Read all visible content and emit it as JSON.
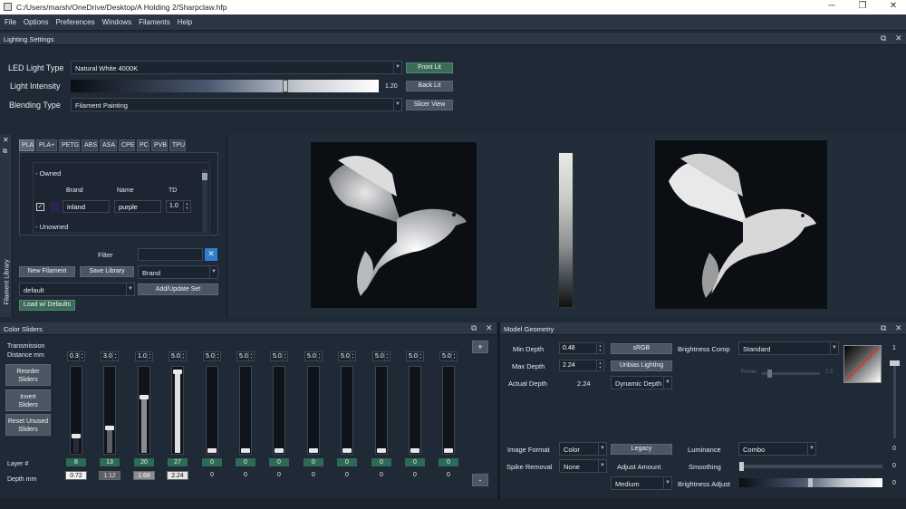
{
  "window": {
    "title": "C:/Users/marsh/OneDrive/Desktop/A Holding 2/Sharpclaw.hfp",
    "minimize": "─",
    "maximize": "❐",
    "close": "✕"
  },
  "menu": [
    "File",
    "Options",
    "Preferences",
    "Windows",
    "Filaments",
    "Help"
  ],
  "lighting": {
    "title": "Lighting Settings",
    "led_label": "LED Light Type",
    "led_value": "Natural White 4000K",
    "intensity_label": "Light Intensity",
    "intensity_value": "1.20",
    "intensity_fraction": 0.7,
    "blending_label": "Blending Type",
    "blending_value": "Filament Painting",
    "front_lit": "Front Lit",
    "back_lit": "Back Lit",
    "slicer_view": "Slicer View"
  },
  "library": {
    "side_label": "Filament Library",
    "tabs": [
      "PLA",
      "PLA+",
      "PETG",
      "ABS",
      "ASA",
      "CPE",
      "PC",
      "PVB",
      "TPU"
    ],
    "owned": "- Owned",
    "unowned": "- Unowned",
    "col_brand": "Brand",
    "col_name": "Name",
    "col_td": "TD",
    "row": {
      "brand": "inland",
      "name": "purple",
      "td": "1.0",
      "swatch": "#2a2350"
    },
    "filter_label": "Filter",
    "new_filament": "New Filament",
    "save_library": "Save Library",
    "sort_value": "Brand",
    "set_value": "default",
    "add_update": "Add/Update Set",
    "load_defaults": "Load w/ Defaults"
  },
  "color_sliders": {
    "title": "Color Sliders",
    "transmission_label": "Transmission\nDistance mm",
    "reorder": "Reorder\nSliders",
    "invert": "Invert\nSliders",
    "reset": "Reset Unused\nSliders",
    "layer_label": "Layer #",
    "depth_label": "Depth mm",
    "plus": "+",
    "minus": "-",
    "sliders": [
      {
        "td": "0.3",
        "level": 0.18,
        "fill": "#2a2a3a",
        "layer": "8",
        "depth": "0.72",
        "depth_style": "white"
      },
      {
        "td": "3.0",
        "level": 0.28,
        "fill": "#5c5f66",
        "layer": "13",
        "depth": "1.12",
        "depth_style": "gray"
      },
      {
        "td": "1.0",
        "level": 0.66,
        "fill": "#8a8c90",
        "layer": "20",
        "depth": "1.68",
        "depth_style": "lgray"
      },
      {
        "td": "5.0",
        "level": 0.97,
        "fill": "#e0e0e0",
        "layer": "27",
        "depth": "2.24",
        "depth_style": "white2"
      },
      {
        "td": "5.0",
        "level": 0,
        "fill": "#0f141a",
        "layer": "0",
        "depth": "0",
        "depth_style": "none"
      },
      {
        "td": "5.0",
        "level": 0,
        "fill": "#0f141a",
        "layer": "0",
        "depth": "0",
        "depth_style": "none"
      },
      {
        "td": "5.0",
        "level": 0,
        "fill": "#0f141a",
        "layer": "0",
        "depth": "0",
        "depth_style": "none"
      },
      {
        "td": "5.0",
        "level": 0,
        "fill": "#0f141a",
        "layer": "0",
        "depth": "0",
        "depth_style": "none"
      },
      {
        "td": "5.0",
        "level": 0,
        "fill": "#0f141a",
        "layer": "0",
        "depth": "0",
        "depth_style": "none"
      },
      {
        "td": "5.0",
        "level": 0,
        "fill": "#0f141a",
        "layer": "0",
        "depth": "0",
        "depth_style": "none"
      },
      {
        "td": "5.0",
        "level": 0,
        "fill": "#0f141a",
        "layer": "0",
        "depth": "0",
        "depth_style": "none"
      },
      {
        "td": "5.0",
        "level": 0,
        "fill": "#0f141a",
        "layer": "0",
        "depth": "0",
        "depth_style": "none"
      }
    ]
  },
  "geometry": {
    "title": "Model Geometry",
    "min_depth_label": "Min Depth",
    "min_depth": "0.48",
    "max_depth_label": "Max Depth",
    "max_depth": "2.24",
    "actual_depth_label": "Actual Depth",
    "actual_depth": "2.24",
    "srgb": "sRGB",
    "unbias": "Unbias Lighting",
    "dynamic_depth": "Dynamic Depth",
    "brightness_comp_label": "Brightness Comp",
    "brightness_comp": "Standard",
    "power_label": "Power",
    "power_value": "2.0",
    "right_value": "1",
    "right_zero": "0",
    "image_format_label": "Image Format",
    "image_format": "Color",
    "legacy": "Legacy",
    "luminance_label": "Luminance",
    "luminance": "Combo",
    "luminance_value": "0",
    "spike_label": "Spike Removal",
    "spike": "None",
    "adjust_amount_label": "Adjust Amount",
    "smoothing_label": "Smoothing",
    "smoothing_value": "0",
    "medium": "Medium",
    "brightness_adjust_label": "Brightness Adjust",
    "brightness_adjust_value": "0"
  },
  "colors": {
    "accent_green": "#3d6b5a",
    "bg": "#1f2a36",
    "blue_x": "#2f7fcf"
  }
}
